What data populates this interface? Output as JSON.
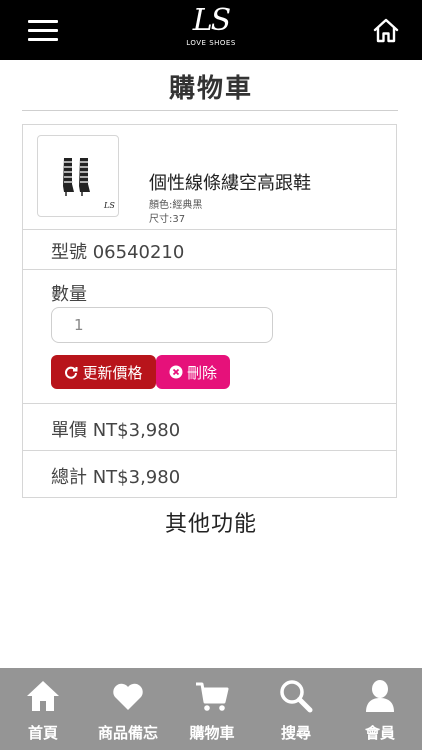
{
  "header": {
    "logo_mark": "LS",
    "logo_sub": "LOVE SHOES"
  },
  "page": {
    "title": "購物車"
  },
  "product": {
    "name": "個性線條縷空高跟鞋",
    "color": "顏色:經典黑",
    "size": "尺寸:37"
  },
  "cart": {
    "model": "型號 06540210",
    "qty_label": "數量",
    "qty_value": "1",
    "update_label": "更新價格",
    "delete_label": "刪除",
    "unit_price": "單價 NT$3,980",
    "total": "總計 NT$3,980"
  },
  "more": {
    "title": "其他功能"
  },
  "nav": {
    "items": [
      {
        "label": "首頁",
        "icon": "home-icon"
      },
      {
        "label": "商品備忘",
        "icon": "heart-icon"
      },
      {
        "label": "購物車",
        "icon": "cart-icon"
      },
      {
        "label": "搜尋",
        "icon": "search-icon"
      },
      {
        "label": "會員",
        "icon": "user-icon"
      }
    ]
  },
  "colors": {
    "topbar": "#000000",
    "update_button": "#b8141b",
    "delete_button": "#e6117a",
    "bottom_nav": "#959595"
  }
}
